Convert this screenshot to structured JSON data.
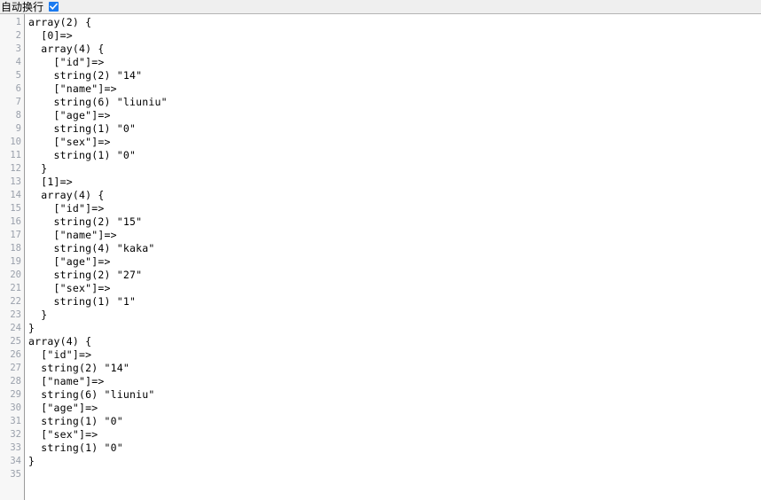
{
  "toolbar": {
    "wrap_label": "自动换行",
    "wrap_checked": true,
    "checkbox_color": "#1a7af0",
    "background": "#efefef"
  },
  "editor": {
    "gutter_background": "#f7f7f7",
    "gutter_text_color": "#9aa0ab",
    "code_background": "#ffffff",
    "code_text_color": "#000000",
    "total_lines": 35,
    "lines": [
      {
        "n": "1",
        "text": "array(2) {"
      },
      {
        "n": "2",
        "text": "  [0]=>"
      },
      {
        "n": "3",
        "text": "  array(4) {"
      },
      {
        "n": "4",
        "text": "    [\"id\"]=>"
      },
      {
        "n": "5",
        "text": "    string(2) \"14\""
      },
      {
        "n": "6",
        "text": "    [\"name\"]=>"
      },
      {
        "n": "7",
        "text": "    string(6) \"liuniu\""
      },
      {
        "n": "8",
        "text": "    [\"age\"]=>"
      },
      {
        "n": "9",
        "text": "    string(1) \"0\""
      },
      {
        "n": "10",
        "text": "    [\"sex\"]=>"
      },
      {
        "n": "11",
        "text": "    string(1) \"0\""
      },
      {
        "n": "12",
        "text": "  }"
      },
      {
        "n": "13",
        "text": "  [1]=>"
      },
      {
        "n": "14",
        "text": "  array(4) {"
      },
      {
        "n": "15",
        "text": "    [\"id\"]=>"
      },
      {
        "n": "16",
        "text": "    string(2) \"15\""
      },
      {
        "n": "17",
        "text": "    [\"name\"]=>"
      },
      {
        "n": "18",
        "text": "    string(4) \"kaka\""
      },
      {
        "n": "19",
        "text": "    [\"age\"]=>"
      },
      {
        "n": "20",
        "text": "    string(2) \"27\""
      },
      {
        "n": "21",
        "text": "    [\"sex\"]=>"
      },
      {
        "n": "22",
        "text": "    string(1) \"1\""
      },
      {
        "n": "23",
        "text": "  }"
      },
      {
        "n": "24",
        "text": "}"
      },
      {
        "n": "25",
        "text": "array(4) {"
      },
      {
        "n": "26",
        "text": "  [\"id\"]=>"
      },
      {
        "n": "27",
        "text": "  string(2) \"14\""
      },
      {
        "n": "28",
        "text": "  [\"name\"]=>"
      },
      {
        "n": "29",
        "text": "  string(6) \"liuniu\""
      },
      {
        "n": "30",
        "text": "  [\"age\"]=>"
      },
      {
        "n": "31",
        "text": "  string(1) \"0\""
      },
      {
        "n": "32",
        "text": "  [\"sex\"]=>"
      },
      {
        "n": "33",
        "text": "  string(1) \"0\""
      },
      {
        "n": "34",
        "text": "}"
      },
      {
        "n": "35",
        "text": ""
      }
    ]
  }
}
